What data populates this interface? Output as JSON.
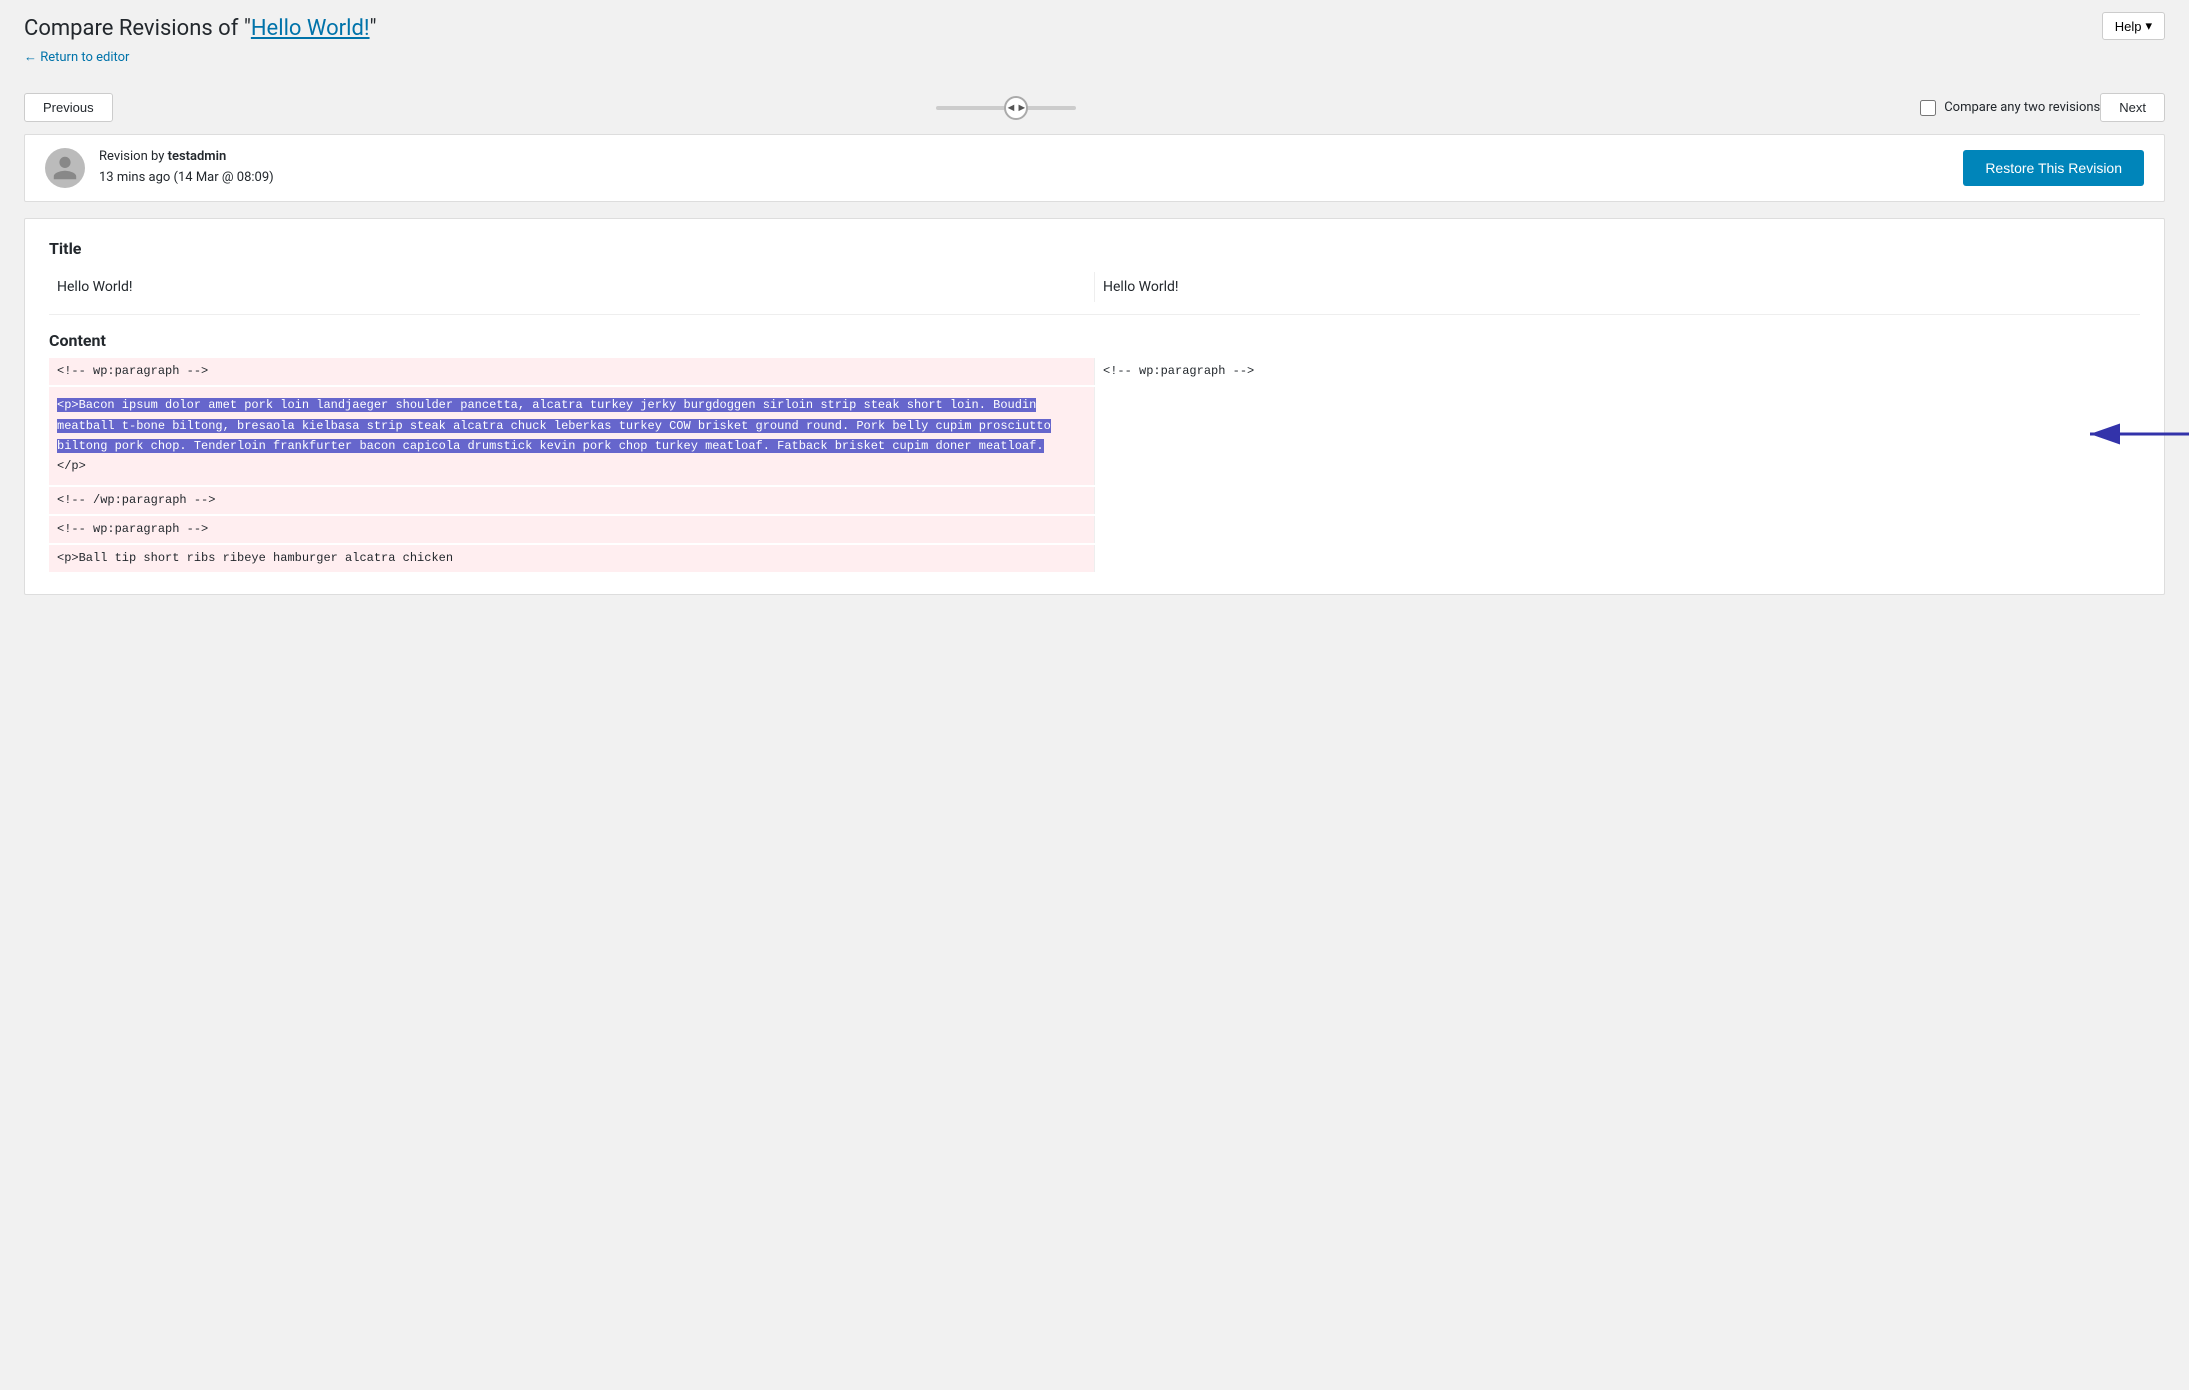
{
  "header": {
    "title_prefix": "Compare Revisions of ",
    "post_title": "Hello World!",
    "post_link": "#",
    "return_label": "← Return to editor",
    "help_label": "Help"
  },
  "controls": {
    "previous_label": "Previous",
    "next_label": "Next",
    "compare_label": "Compare any two revisions"
  },
  "revision": {
    "by_label": "Revision by ",
    "author": "testadmin",
    "time_ago": "13 mins ago",
    "date": "(14 Mar @ 08:09)",
    "restore_label": "Restore This Revision"
  },
  "diff": {
    "title_section": "Title",
    "title_left": "Hello World!",
    "title_right": "Hello World!",
    "content_section": "Content",
    "comment1_left": "<!-- wp:paragraph -->",
    "comment1_right": "<!-- wp:paragraph -->",
    "removed_block": "<p>Bacon ipsum dolor amet pork loin landjaeger shoulder pancetta, alcatra turkey jerky burgdoggen sirloin strip steak short loin. Boudin meatball t-bone biltong, bresaola kielbasa strip steak alcatra chuck leberkas turkey cow brisket ground round. Pork belly cupim prosciutto biltong pork chop. Tenderloin frankfurter bacon capicola drumstick kevin pork chop turkey meatloaf. Fatback brisket cupim doner meatloaf.</p>",
    "removed_block_end": "</p>",
    "comment2_left": "<!-- /wp:paragraph -->",
    "comment3_left": "<!-- wp:paragraph -->",
    "added_block_start": "<p>Ball tip short ribs ribeye hamburger alcatra chicken"
  },
  "icons": {
    "help_chevron": "▾",
    "slider_arrows": "◄►"
  }
}
